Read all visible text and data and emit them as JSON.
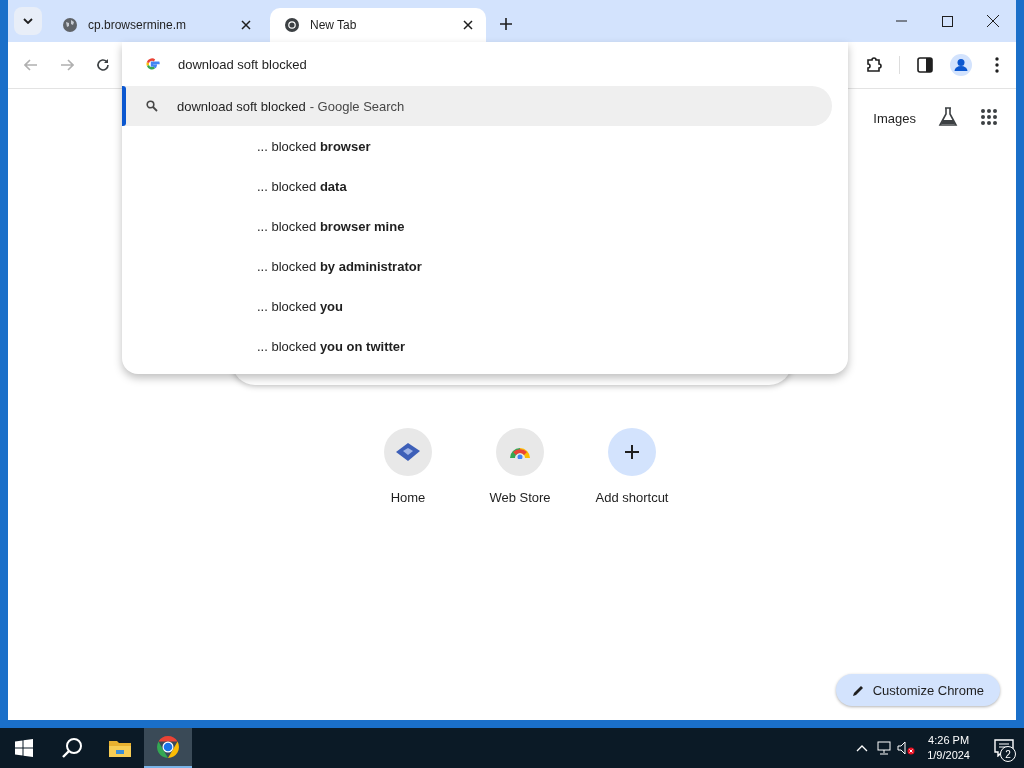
{
  "tabs": [
    {
      "title": "cp.browsermine.m",
      "kind": "site",
      "selected": false
    },
    {
      "title": "New Tab",
      "kind": "chrome",
      "selected": true
    }
  ],
  "omnibox": {
    "value": "download soft blocked"
  },
  "suggestions": [
    {
      "kind": "search",
      "text": "download soft blocked",
      "suffix": "- Google Search",
      "selected": true
    },
    {
      "kind": "completion",
      "text": "... blocked **browser**",
      "selected": false
    },
    {
      "kind": "completion",
      "text": "... blocked **data**",
      "selected": false
    },
    {
      "kind": "completion",
      "text": "... blocked **browser mine**",
      "selected": false
    },
    {
      "kind": "completion",
      "text": "... blocked **by administrator**",
      "selected": false
    },
    {
      "kind": "completion",
      "text": "... blocked **you**",
      "selected": false
    },
    {
      "kind": "completion",
      "text": "... blocked **you on twitter**",
      "selected": false
    }
  ],
  "images_link": "Images",
  "shortcuts": [
    {
      "label": "Home",
      "kind": "site"
    },
    {
      "label": "Web Store",
      "kind": "store"
    },
    {
      "label": "Add shortcut",
      "kind": "add"
    }
  ],
  "customize_button": "Customize Chrome",
  "taskbar": {
    "time": "4:26 PM",
    "date": "1/9/2024",
    "notifications": "2"
  }
}
